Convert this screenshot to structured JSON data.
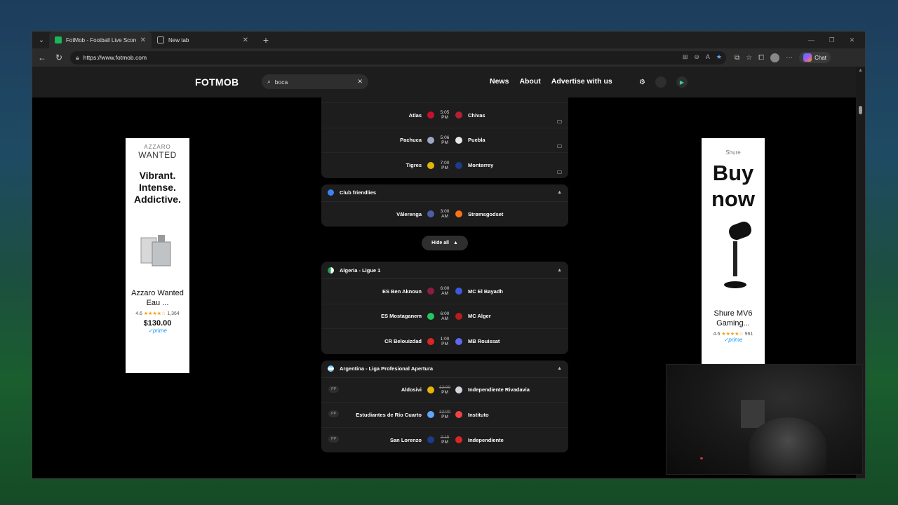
{
  "browser": {
    "tabs": [
      {
        "title": "FotMob - Football Live Scores",
        "active": true
      },
      {
        "title": "New tab",
        "active": false
      }
    ],
    "url": "https://www.fotmob.com",
    "chat_label": "Chat"
  },
  "site": {
    "logo": "FOTMOB",
    "search_value": "boca",
    "nav": [
      "News",
      "About",
      "Advertise with us"
    ]
  },
  "ads": {
    "left": {
      "brand": "AZZARO",
      "brand2": "WANTED",
      "headline": [
        "Vibrant.",
        "Intense.",
        "Addictive."
      ],
      "product": "Azzaro Wanted Eau ...",
      "rating": "4.6",
      "reviews": "1,364",
      "price": "$130.00",
      "prime": "prime"
    },
    "right": {
      "brand": "Shure",
      "headline": [
        "Buy",
        "now"
      ],
      "product": "Shure MV6 Gaming...",
      "rating": "4.6",
      "reviews": "961",
      "prime": "prime"
    }
  },
  "leagues": [
    {
      "name": "",
      "matches": [
        {
          "home": "Atlas",
          "time": "5:05",
          "ampm": "PM",
          "away": "Chivas"
        },
        {
          "home": "Pachuca",
          "time": "5:06",
          "ampm": "PM",
          "away": "Puebla"
        },
        {
          "home": "Tigres",
          "time": "7:00",
          "ampm": "PM",
          "away": "Monterrey"
        }
      ]
    },
    {
      "name": "Club friendlies",
      "matches": [
        {
          "home": "Vålerenga",
          "time": "3:00",
          "ampm": "AM",
          "away": "Strømsgodset"
        }
      ]
    },
    {
      "name": "Algeria - Ligue 1",
      "matches": [
        {
          "home": "ES Ben Aknoun",
          "time": "6:00",
          "ampm": "AM",
          "away": "MC El Bayadh"
        },
        {
          "home": "ES Mostaganem",
          "time": "6:00",
          "ampm": "AM",
          "away": "MC Alger"
        },
        {
          "home": "CR Belouizdad",
          "time": "1:00",
          "ampm": "PM",
          "away": "MB Rouissat"
        }
      ]
    },
    {
      "name": "Argentina - Liga Profesional Apertura",
      "matches": [
        {
          "home": "Aldosivi",
          "time": "12:00",
          "ampm": "PM",
          "away": "Independiente Rivadavia",
          "status": "PP"
        },
        {
          "home": "Estudiantes de Río Cuarto",
          "time": "12:00",
          "ampm": "PM",
          "away": "Instituto",
          "status": "PP"
        },
        {
          "home": "San Lorenzo",
          "time": "2:15",
          "ampm": "PM",
          "away": "Independiente",
          "status": "PP"
        }
      ]
    }
  ],
  "hide_all_label": "Hide all"
}
